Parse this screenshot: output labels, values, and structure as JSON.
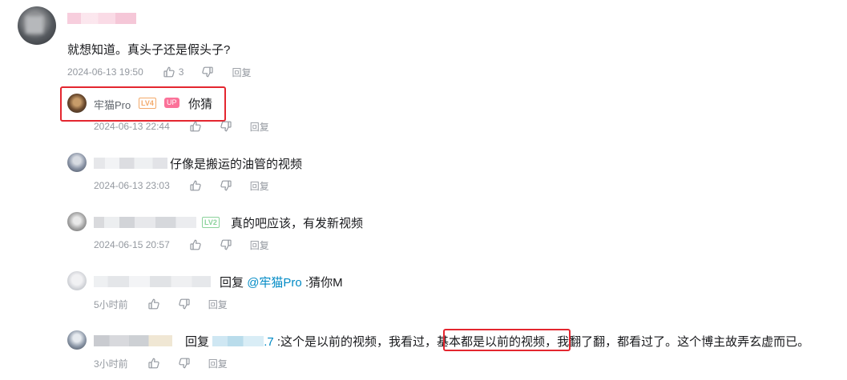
{
  "top_comment": {
    "content": "就想知道。真头子还是假头子?",
    "date": "2024-06-13 19:50",
    "likes": "3",
    "reply_label": "回复"
  },
  "replies": [
    {
      "user": "牢猫Pro",
      "level": "LV4",
      "badge": "UP",
      "text": "你猜",
      "date": "2024-06-13 22:44",
      "reply_label": "回复"
    },
    {
      "text": "仔像是搬运的油管的视频",
      "date": "2024-06-13 23:03",
      "reply_label": "回复"
    },
    {
      "level": "LV2",
      "text": "真的吧应该，有发新视频",
      "date": "2024-06-15 20:57",
      "reply_label": "回复"
    },
    {
      "reply_prefix": "回复",
      "mention": "@牢猫Pro",
      "text": ":猜你M",
      "date": "5小时前",
      "reply_label": "回复"
    },
    {
      "reply_prefix": "回复",
      "mention_tail": ".7",
      "text_a": ":这个是以前的视频，我看过，",
      "text_b": "基本都是以前的视频",
      "text_c": "，我翻了翻，都看过了。这个博主故弄玄虚而已。",
      "date": "3小时前",
      "reply_label": "回复"
    }
  ],
  "colors": {
    "highlight_box": "#e4262f",
    "mention": "#008ac5",
    "meta_gray": "#9499a0",
    "up_badge": "#fb7299"
  }
}
